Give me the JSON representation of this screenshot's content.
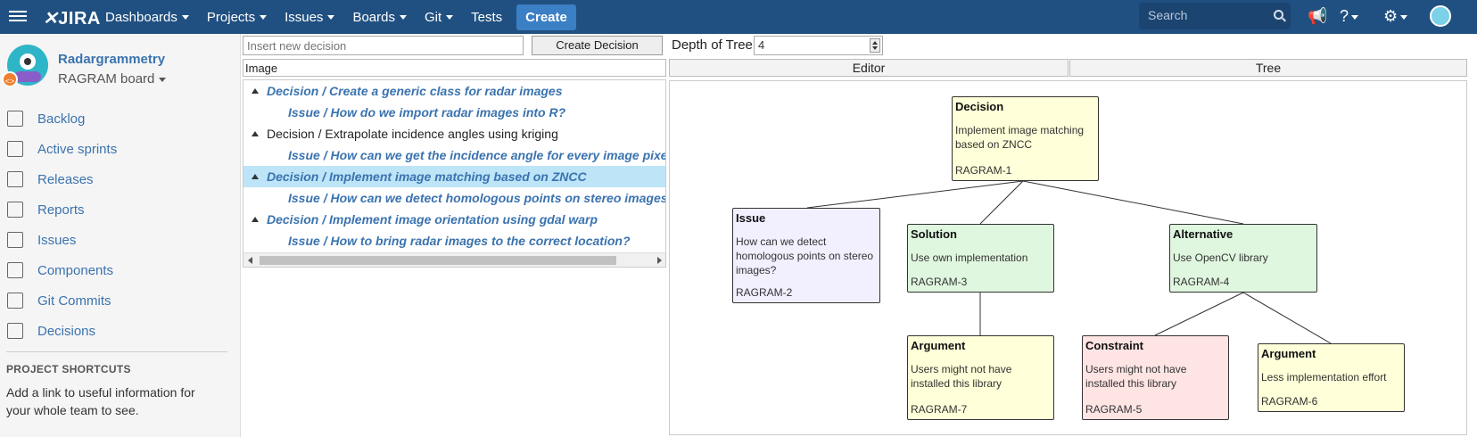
{
  "topbar": {
    "logo": "JIRA",
    "nav": [
      {
        "label": "Dashboards",
        "caret": true
      },
      {
        "label": "Projects",
        "caret": true
      },
      {
        "label": "Issues",
        "caret": true
      },
      {
        "label": "Boards",
        "caret": true
      },
      {
        "label": "Git",
        "caret": true
      },
      {
        "label": "Tests",
        "caret": false
      }
    ],
    "create_label": "Create",
    "search_placeholder": "Search"
  },
  "sidebar": {
    "project_name": "Radargrammetry",
    "board_name": "RAGRAM board",
    "items": [
      {
        "label": "Backlog",
        "icon": "backlog-icon"
      },
      {
        "label": "Active sprints",
        "icon": "sprints-icon"
      },
      {
        "label": "Releases",
        "icon": "releases-icon"
      },
      {
        "label": "Reports",
        "icon": "reports-icon"
      },
      {
        "label": "Issues",
        "icon": "issues-icon"
      },
      {
        "label": "Components",
        "icon": "components-icon"
      },
      {
        "label": "Git Commits",
        "icon": "git-commits-icon"
      },
      {
        "label": "Decisions",
        "icon": "decisions-icon"
      }
    ],
    "shortcuts_title": "PROJECT SHORTCUTS",
    "shortcuts_text": "Add a link to useful information for your whole team to see."
  },
  "toolbar": {
    "decision_placeholder": "Insert new decision",
    "create_decision_label": "Create Decision",
    "depth_label": "Depth of Tree",
    "depth_value": "4"
  },
  "tree": {
    "header": "Image",
    "rows": [
      {
        "text": "Decision / Create a generic class for radar images",
        "style": "link",
        "level": 0,
        "toggle": true,
        "selected": false
      },
      {
        "text": "Issue / How do we import radar images into R?",
        "style": "link",
        "level": 1,
        "toggle": false,
        "selected": false
      },
      {
        "text": "Decision / Extrapolate incidence angles using kriging",
        "style": "plain",
        "level": 0,
        "toggle": true,
        "selected": false
      },
      {
        "text": "Issue / How can we get the incidence angle for every image pixel?",
        "style": "link",
        "level": 1,
        "toggle": false,
        "selected": false
      },
      {
        "text": "Decision / Implement image matching based on ZNCC",
        "style": "link",
        "level": 0,
        "toggle": true,
        "selected": true
      },
      {
        "text": "Issue / How can we detect homologous points on stereo images?",
        "style": "link",
        "level": 1,
        "toggle": false,
        "selected": false
      },
      {
        "text": "Decision / Implement image orientation using gdal warp",
        "style": "link",
        "level": 0,
        "toggle": true,
        "selected": false
      },
      {
        "text": "Issue / How to bring radar images to the correct location?",
        "style": "link",
        "level": 1,
        "toggle": false,
        "selected": false
      }
    ]
  },
  "tabs": {
    "editor": "Editor",
    "tree": "Tree"
  },
  "graph": {
    "nodes": [
      {
        "id": "decision",
        "type": "Decision",
        "text": "Implement image matching based on ZNCC",
        "key": "RAGRAM-1",
        "kind": "decision"
      },
      {
        "id": "issue",
        "type": "Issue",
        "text": "How can we detect homologous points on stereo images?",
        "key": "RAGRAM-2",
        "kind": "issue"
      },
      {
        "id": "solution",
        "type": "Solution",
        "text": "Use own implementation",
        "key": "RAGRAM-3",
        "kind": "solution"
      },
      {
        "id": "alternative",
        "type": "Alternative",
        "text": "Use OpenCV library",
        "key": "RAGRAM-4",
        "kind": "alternative"
      },
      {
        "id": "argument7",
        "type": "Argument",
        "text": "Users might not have installed this library",
        "key": "RAGRAM-7",
        "kind": "argument"
      },
      {
        "id": "constraint",
        "type": "Constraint",
        "text": "Users might not have installed this library",
        "key": "RAGRAM-5",
        "kind": "constraint"
      },
      {
        "id": "argument6",
        "type": "Argument",
        "text": "Less implementation effort",
        "key": "RAGRAM-6",
        "kind": "argument"
      }
    ]
  }
}
